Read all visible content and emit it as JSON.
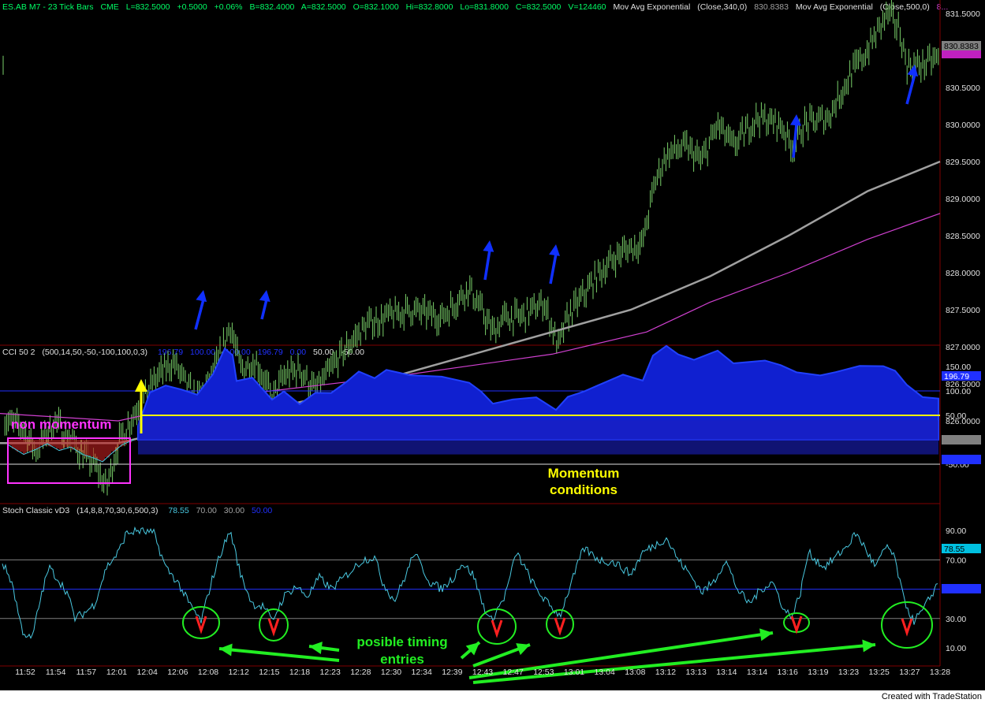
{
  "header": {
    "fields": [
      "ES.AB M7 - 23 Tick Bars",
      "CME",
      "L=832.5000",
      "+0.5000",
      "+0.06%",
      "B=832.4000",
      "A=832.5000",
      "O=832.1000",
      "Hi=832.8000",
      "Lo=831.8000",
      "C=832.5000",
      "V=124460",
      "Mov Avg Exponential",
      "(Close,340,0)",
      "830.8383",
      "Mov Avg Exponential",
      "(Close,500,0)",
      "8..."
    ]
  },
  "price_panel": {
    "ticks": [
      "831.5000",
      "831.0000",
      "830.5000",
      "830.0000",
      "829.5000",
      "829.0000",
      "828.5000",
      "828.0000",
      "827.5000",
      "827.0000",
      "826.5000",
      "826.0000",
      "825.5000"
    ],
    "ma_label": "830.8383",
    "last_label": "830.6..."
  },
  "cci_panel": {
    "title": "CCI 50 2",
    "params": "(500,14,50,-50,-100,100,0,3)",
    "values": [
      "196.79",
      "100.00",
      "-100.00",
      "196.79",
      "0.00",
      "50.00",
      "-50.00"
    ],
    "ticks": [
      "150.00",
      "100.00",
      "50.00",
      "-50.00"
    ],
    "value_label": "196.79",
    "annotation_non_momentum": "non momentum",
    "annotation_momentum": [
      "Momentum",
      "conditions"
    ]
  },
  "stoch_panel": {
    "title": "Stoch Classic vD3",
    "params": "(14,8,8,70,30,6,500,3)",
    "values": [
      "78.55",
      "70.00",
      "30.00",
      "50.00"
    ],
    "ticks": [
      "90.00",
      "70.00",
      "50.00",
      "30.00",
      "10.00"
    ],
    "value_label": "78.55",
    "annotation": [
      "posible timing",
      "entries"
    ]
  },
  "time_axis": [
    "11:52",
    "11:54",
    "11:57",
    "12:01",
    "12:04",
    "12:06",
    "12:08",
    "12:12",
    "12:15",
    "12:18",
    "12:23",
    "12:28",
    "12:30",
    "12:34",
    "12:39",
    "12:43",
    "12:47",
    "12:53",
    "13:01",
    "13:04",
    "13:08",
    "13:12",
    "13:13",
    "13:14",
    "13:14",
    "13:16",
    "13:19",
    "13:23",
    "13:25",
    "13:27",
    "13:28"
  ],
  "footer": "Created with TradeStation",
  "colors": {
    "price_bars": "#7ad16a",
    "ma340": "#a0a0a0",
    "ma500": "#d040d0",
    "cci_fill": "#1020d0",
    "stoch_line": "#49c8e0",
    "arrow_blue": "#1030ff",
    "annotation_green": "#22ee22",
    "annotation_yellow": "#ffff00",
    "annotation_magenta": "#ff33ff"
  }
}
